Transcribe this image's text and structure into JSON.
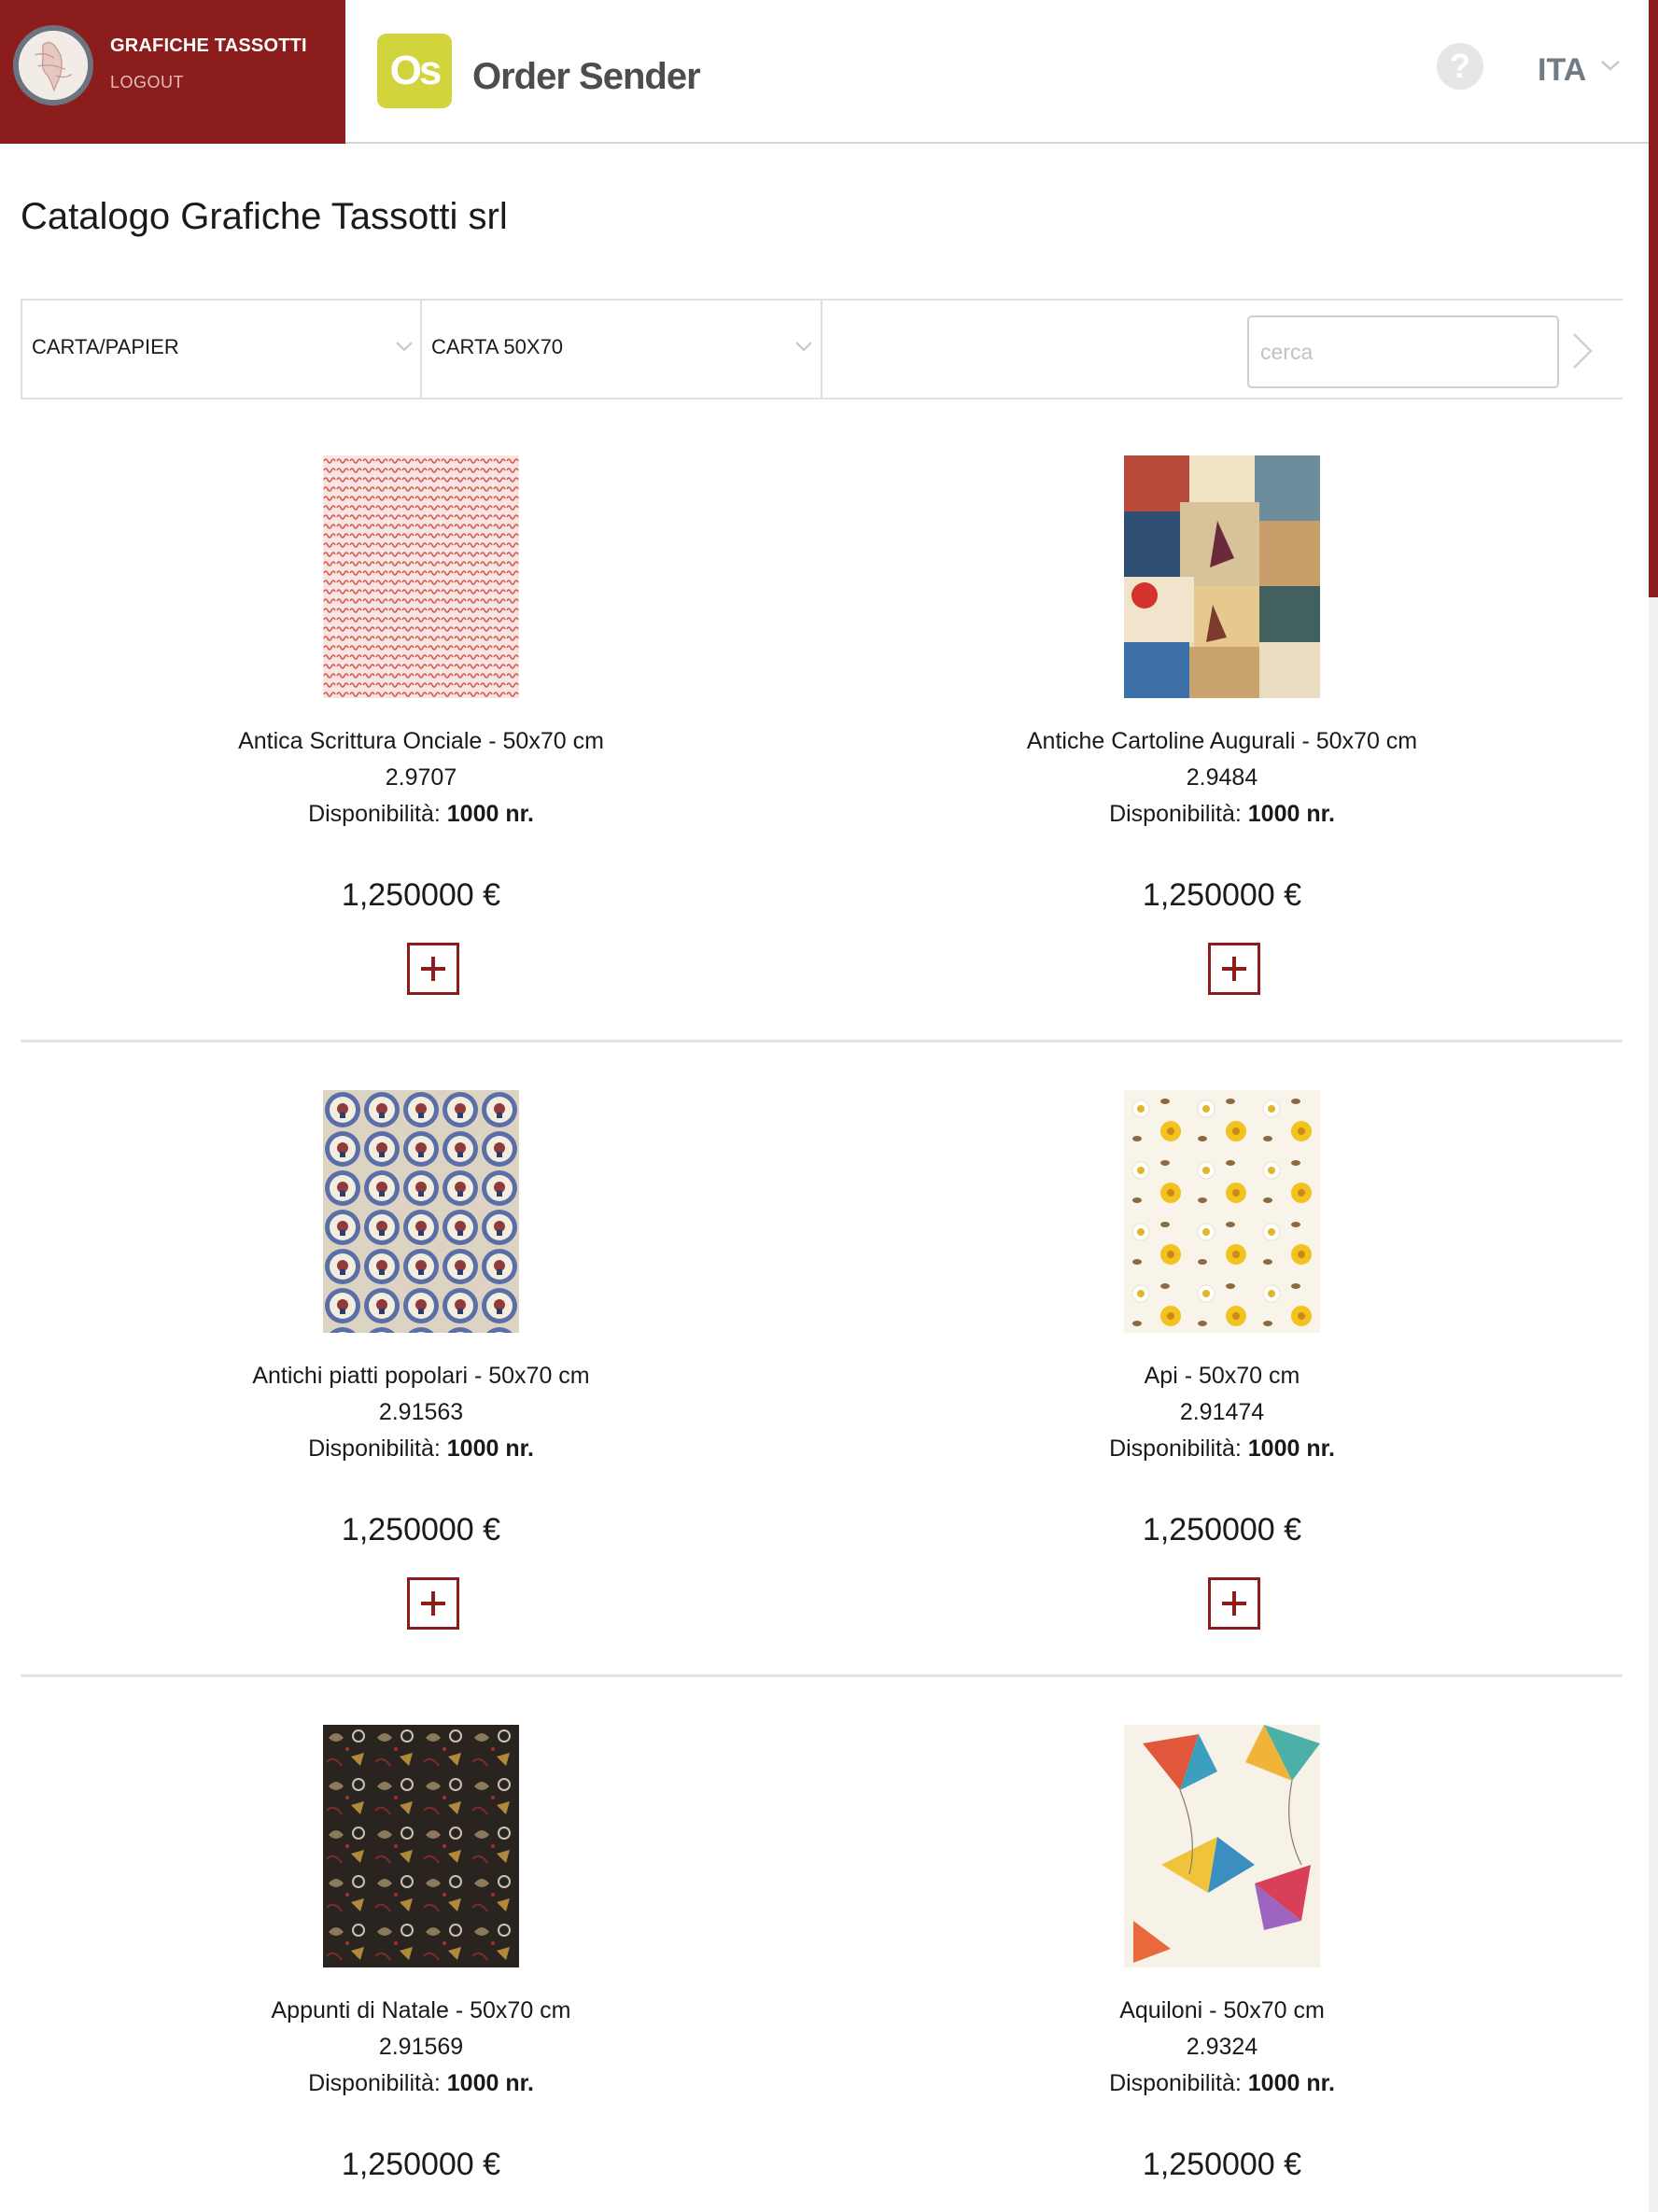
{
  "header": {
    "account_name": "GRAFICHE TASSOTTI",
    "logout_label": "LOGOUT",
    "brand_mark": "Os",
    "brand_name": "Order Sender",
    "help_label": "?",
    "language": "ITA"
  },
  "page": {
    "title": "Catalogo Grafiche Tassotti srl"
  },
  "filters": {
    "category": "CARTA/PAPIER",
    "subcategory": "CARTA 50X70",
    "third": "",
    "search_placeholder": "cerca"
  },
  "availability_label": "Disponibilità:",
  "products": [
    {
      "name": "Antica Scrittura Onciale - 50x70 cm",
      "code": "2.9707",
      "availability": "1000 nr.",
      "price": "1,250000 €"
    },
    {
      "name": "Antiche Cartoline Augurali - 50x70 cm",
      "code": "2.9484",
      "availability": "1000 nr.",
      "price": "1,250000 €"
    },
    {
      "name": "Antichi piatti popolari - 50x70 cm",
      "code": "2.91563",
      "availability": "1000 nr.",
      "price": "1,250000 €"
    },
    {
      "name": "Api - 50x70 cm",
      "code": "2.91474",
      "availability": "1000 nr.",
      "price": "1,250000 €"
    },
    {
      "name": "Appunti di Natale - 50x70 cm",
      "code": "2.91569",
      "availability": "1000 nr.",
      "price": "1,250000 €"
    },
    {
      "name": "Aquiloni - 50x70 cm",
      "code": "2.9324",
      "availability": "1000 nr.",
      "price": "1,250000 €"
    }
  ],
  "colors": {
    "brand": "#8c1d1d",
    "logo": "#d2d43c",
    "divider": "#e3e3e3"
  }
}
